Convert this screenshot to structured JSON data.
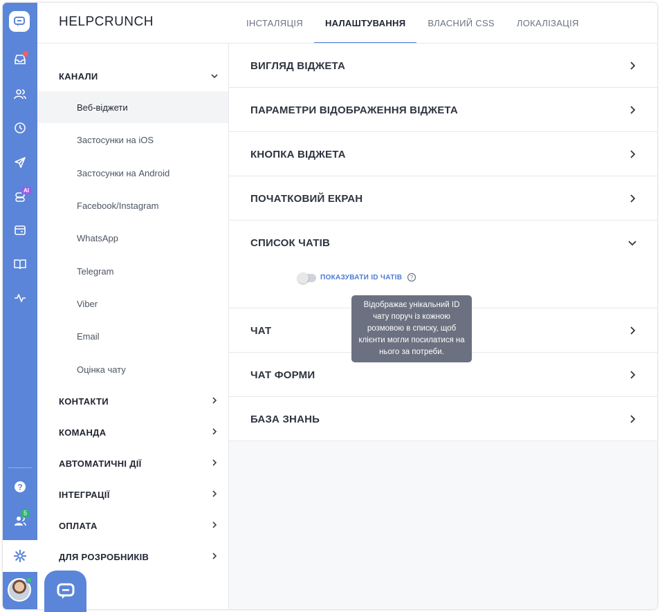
{
  "app": {
    "brand": "HELPCRUNCH"
  },
  "tabs": [
    {
      "label": "ІНСТАЛЯЦІЯ",
      "active": false
    },
    {
      "label": "НАЛАШТУВАННЯ",
      "active": true
    },
    {
      "label": "ВЛАСНИЙ CSS",
      "active": false
    },
    {
      "label": "ЛОКАЛІЗАЦІЯ",
      "active": false
    }
  ],
  "rail": {
    "icons": [
      "chat-logo-icon",
      "inbox-icon",
      "contacts-icon",
      "history-icon",
      "send-icon",
      "ai-bot-icon",
      "widget-icon",
      "book-icon",
      "activity-icon",
      "help-icon",
      "team-icon",
      "settings-icon"
    ],
    "ai_badge": "AI",
    "team_badge": "5",
    "accent": "#5b85d8"
  },
  "nav": {
    "channels": {
      "label": "КАНАЛИ",
      "items": [
        "Веб-віджети",
        "Застосунки на iOS",
        "Застосунки на Android",
        "Facebook/Instagram",
        "WhatsApp",
        "Telegram",
        "Viber",
        "Email",
        "Оцінка чату"
      ],
      "active_index": 0
    },
    "sections": [
      "КОНТАКТИ",
      "КОМАНДА",
      "АВТОМАТИЧНІ ДІЇ",
      "ІНТЕГРАЦІЇ",
      "ОПЛАТА",
      "ДЛЯ РОЗРОБНИКІВ"
    ]
  },
  "accordion": {
    "items": [
      "ВИГЛЯД ВІДЖЕТА",
      "ПАРАМЕТРИ ВІДОБРАЖЕННЯ ВІДЖЕТА",
      "КНОПКА ВІДЖЕТА",
      "ПОЧАТКОВИЙ ЕКРАН",
      "СПИСОК ЧАТІВ",
      "ЧАТ",
      "ЧАТ ФОРМИ",
      "БАЗА ЗНАНЬ"
    ],
    "expanded_index": 4,
    "chat_list": {
      "toggle_label": "ПОКАЗУВАТИ ID ЧАТІВ",
      "toggle_on": false,
      "tooltip": "Відображає унікальний ID чату поруч із кожною розмовою в списку, щоб клієнти могли посилатися на нього за потреби."
    }
  }
}
